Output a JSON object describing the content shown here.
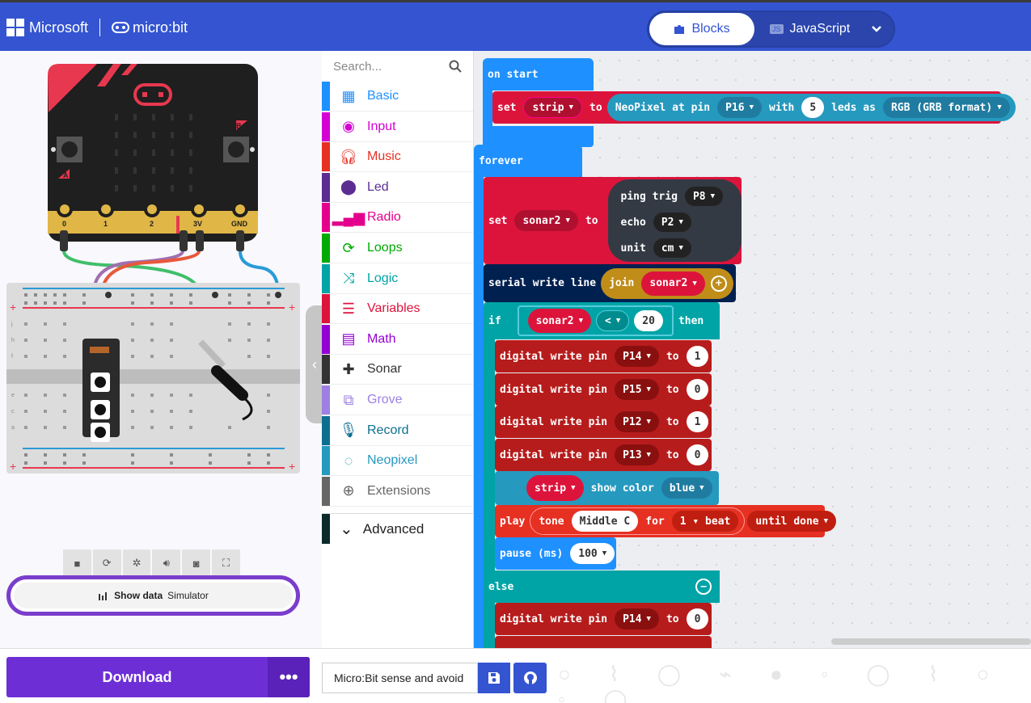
{
  "header": {
    "ms_label": "Microsoft",
    "mb_label": "micro:bit",
    "tabs": [
      {
        "label": "Blocks",
        "active": true
      },
      {
        "label": "JavaScript",
        "active": false
      }
    ],
    "js_badge": "JS",
    "accent": "#3454d1"
  },
  "simulator": {
    "board": {
      "buttons": [
        "A",
        "B"
      ],
      "pins": [
        "0",
        "1",
        "2",
        "3V",
        "GND"
      ],
      "color": "#1f1f1f",
      "accent": "#e8384f"
    },
    "breadboard": {
      "rows": [
        "a",
        "b",
        "c",
        "d",
        "e",
        "f",
        "g",
        "h",
        "i",
        "j"
      ]
    },
    "controls": [
      "stop-icon",
      "restart-icon",
      "debug-icon",
      "mute-icon",
      "screenshot-icon",
      "fullscreen-icon"
    ],
    "show_data": {
      "bold": "Show data",
      "label": "Simulator"
    }
  },
  "toolbox": {
    "search_placeholder": "Search...",
    "categories": [
      {
        "label": "Basic",
        "color": "#1e90ff"
      },
      {
        "label": "Input",
        "color": "#d400d4"
      },
      {
        "label": "Music",
        "color": "#e63022"
      },
      {
        "label": "Led",
        "color": "#5c2d91"
      },
      {
        "label": "Radio",
        "color": "#e3008c"
      },
      {
        "label": "Loops",
        "color": "#00aa00"
      },
      {
        "label": "Logic",
        "color": "#00a4a6"
      },
      {
        "label": "Variables",
        "color": "#dc143c"
      },
      {
        "label": "Math",
        "color": "#9400d3"
      },
      {
        "label": "Sonar",
        "color": "#333333"
      },
      {
        "label": "Grove",
        "color": "#9e7fe2"
      },
      {
        "label": "Record",
        "color": "#0d6f90"
      },
      {
        "label": "Neopixel",
        "color": "#2699bf"
      },
      {
        "label": "Extensions",
        "color": "#666666"
      }
    ],
    "advanced": "Advanced"
  },
  "blocks": {
    "on_start": "on start",
    "set": "set",
    "strip": "strip",
    "to": "to",
    "neopixel_at_pin": "NeoPixel at pin",
    "p16": "P16",
    "with": "with",
    "leds_count": "5",
    "leds_as": "leds as",
    "rgb_format": "RGB (GRB format)",
    "forever": "forever",
    "sonar2": "sonar2",
    "ping_trig": "ping trig",
    "p8": "P8",
    "echo": "echo",
    "p2": "P2",
    "unit": "unit",
    "cm": "cm",
    "serial_write_line": "serial write line",
    "join": "join",
    "if": "if",
    "lt": "<",
    "twenty": "20",
    "then": "then",
    "digital_write_pin": "digital write pin",
    "p14": "P14",
    "p15": "P15",
    "p12": "P12",
    "p13": "P13",
    "one": "1",
    "zero": "0",
    "show_color": "show color",
    "blue": "blue",
    "play": "play",
    "tone": "tone",
    "middle_c": "Middle C",
    "for": "for",
    "beat": "1 ▾ beat",
    "until_done": "until done",
    "pause": "pause (ms)",
    "hundred": "100",
    "else": "else"
  },
  "footer": {
    "download": "Download",
    "project_name": "Micro:Bit sense and avoid"
  }
}
